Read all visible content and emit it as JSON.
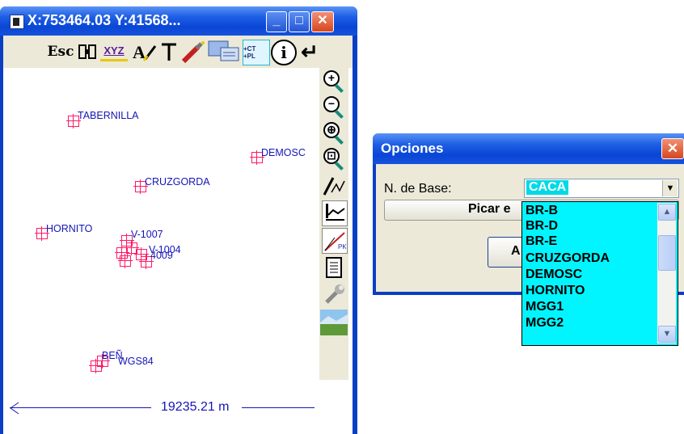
{
  "main_window": {
    "title": "X:753464.03 Y:41568...",
    "buttons": {
      "minimize": "_",
      "maximize": "□",
      "close": "✕"
    }
  },
  "toolbar": {
    "esc_label": "Esc",
    "xyz_label": "XYZ",
    "ctpl_label": "+CT +PL",
    "info_label": "i",
    "enter_label": "↵"
  },
  "vertical_toolbar": {
    "icons": [
      "zoom-in-icon",
      "zoom-out-icon",
      "zoom-center-icon",
      "zoom-window-icon",
      "pencil-line-icon",
      "profile-icon",
      "slope-icon",
      "document-icon",
      "wrench-icon",
      "landscape-icon"
    ]
  },
  "map": {
    "points": [
      {
        "label": "TABERNILLA"
      },
      {
        "label": "DEMOSC"
      },
      {
        "label": "CRUZGORDA"
      },
      {
        "label": "HORNITO"
      },
      {
        "label": "V-1007"
      },
      {
        "label": "V-1004"
      },
      {
        "label": "4009"
      },
      {
        "label": "BEÑ"
      },
      {
        "label": "WGS84"
      }
    ],
    "scale": "19235.21 m"
  },
  "options_dialog": {
    "title": "Opciones",
    "base_label": "N. de Base:",
    "base_value": "CACA",
    "picar_label": "Picar e",
    "accept_label": "A",
    "list": [
      "BR-B",
      "BR-D",
      "BR-E",
      "CRUZGORDA",
      "DEMOSC",
      "HORNITO",
      "MGG1",
      "MGG2"
    ]
  },
  "colors": {
    "title_bar": "#0a46d6",
    "map_label": "#1515b8",
    "cross": "#ff1a66",
    "highlight": "#00d9e6",
    "dropdown_bg": "#00f5ff"
  }
}
